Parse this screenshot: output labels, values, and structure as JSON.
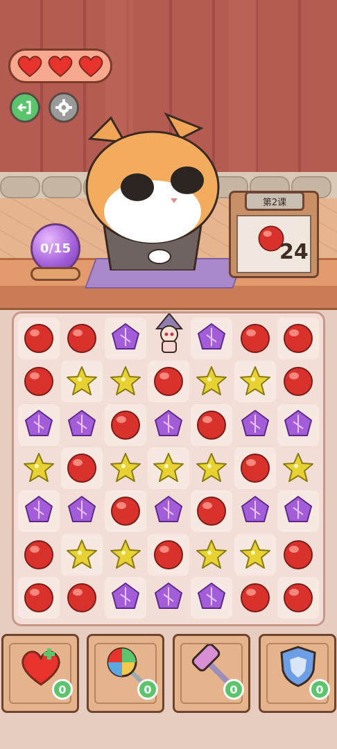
{
  "hud": {
    "lives": 3,
    "exit_icon": "exit-icon",
    "settings_icon": "gear-icon"
  },
  "crystal_ball": {
    "progress_text": "0/15"
  },
  "lesson": {
    "title": "第2课",
    "target_gem": "red",
    "target_count": "24"
  },
  "board": {
    "rows": [
      [
        "red",
        "red",
        "purple",
        "empty",
        "purple",
        "red",
        "red"
      ],
      [
        "red",
        "yellow",
        "yellow",
        "red",
        "yellow",
        "yellow",
        "red"
      ],
      [
        "purple",
        "purple",
        "red",
        "purple",
        "red",
        "purple",
        "purple"
      ],
      [
        "yellow",
        "red",
        "yellow",
        "yellow",
        "yellow",
        "red",
        "yellow"
      ],
      [
        "purple",
        "purple",
        "red",
        "purple",
        "red",
        "purple",
        "purple"
      ],
      [
        "red",
        "yellow",
        "yellow",
        "red",
        "yellow",
        "yellow",
        "red"
      ],
      [
        "red",
        "red",
        "purple",
        "purple",
        "purple",
        "red",
        "red"
      ]
    ]
  },
  "tools": [
    {
      "name": "heart-plus",
      "count": "0"
    },
    {
      "name": "rainbow-lollipop",
      "count": "0"
    },
    {
      "name": "hammer",
      "count": "0"
    },
    {
      "name": "shield",
      "count": "0"
    }
  ],
  "colors": {
    "red": "#d9312c",
    "yellow": "#e8d233",
    "purple": "#a45dd8",
    "badge": "#5cc46d"
  }
}
